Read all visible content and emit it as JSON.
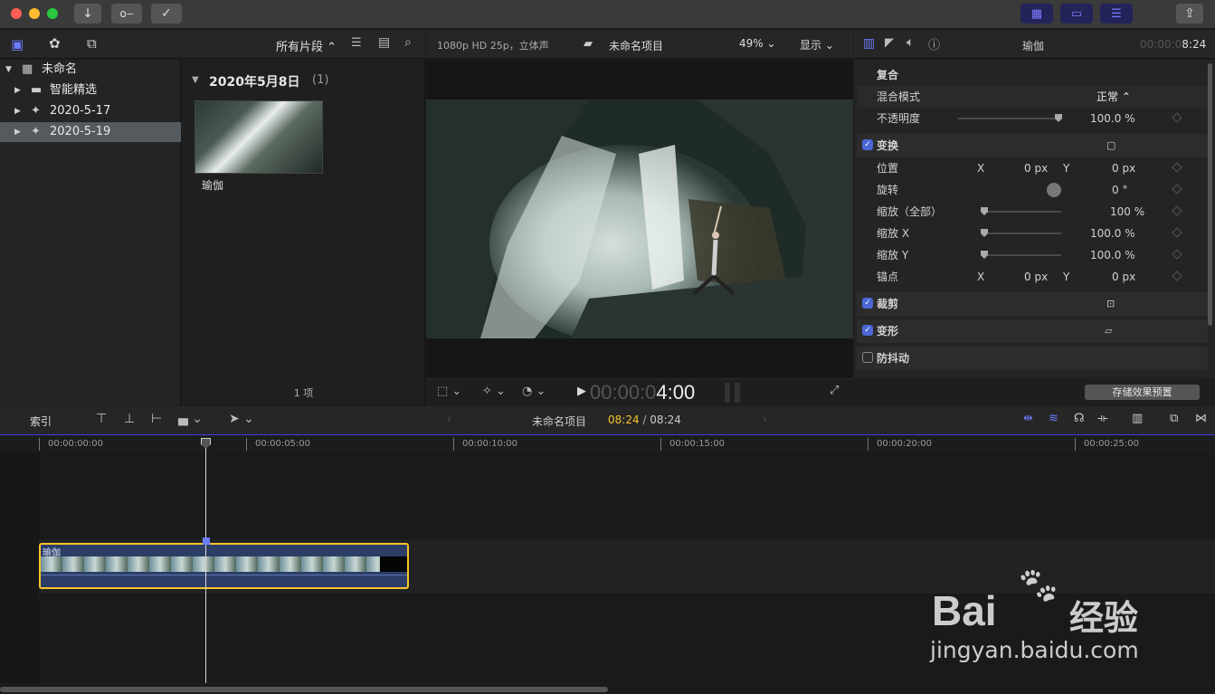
{
  "colors": {
    "accent": "#4b67d6",
    "yellow": "#f7c52a",
    "titlebar": "#3a3a3a"
  },
  "titlebar": {
    "icons": [
      "import-icon",
      "key-icon",
      "checkmark-circle-icon",
      "browser-grid-icon",
      "timeline-icon",
      "inspector-icon",
      "share-icon"
    ]
  },
  "browser": {
    "filter": "所有片段",
    "library": "未命名",
    "items": [
      {
        "label": "智能精选"
      },
      {
        "label": "2020-5-17"
      },
      {
        "label": "2020-5-19"
      }
    ],
    "date_header": "2020年5月8日",
    "date_count": "(1)",
    "clip_name": "瑜伽",
    "item_count": "1 项"
  },
  "viewer": {
    "format": "1080p HD 25p，立体声",
    "project": "未命名项目",
    "zoom": "49%",
    "display": "显示",
    "timecode_dim": "00:00:0",
    "timecode_bright": "4:00"
  },
  "inspector": {
    "title": "瑜伽",
    "timecode_dim": "00:00:0",
    "timecode_bright": "8:24",
    "composite": "复合",
    "blend_mode_label": "混合模式",
    "blend_mode_value": "正常",
    "opacity_label": "不透明度",
    "opacity_value": "100.0",
    "opacity_level": 1.0,
    "transform": "变换",
    "position_label": "位置",
    "x_label": "X",
    "y_label": "Y",
    "pos_x": "0",
    "pos_y": "0",
    "px": "px",
    "rotation_label": "旋转",
    "rotation_value": "0",
    "degree": "°",
    "scale_all_label": "缩放（全部）",
    "scale_all_value": "100",
    "scale_x_label": "缩放 X",
    "scale_x_value": "100.0",
    "scale_y_label": "缩放 Y",
    "scale_y_value": "100.0",
    "percent": "%",
    "anchor_label": "锚点",
    "anchor_x": "0",
    "anchor_y": "0",
    "crop": "裁剪",
    "distort": "变形",
    "stabilization": "防抖动",
    "save_preset": "存储效果预置"
  },
  "timeline": {
    "index": "索引",
    "project": "未命名项目",
    "current": "08:24",
    "separator": "/",
    "duration": "08:24",
    "clip_label": "瑜伽",
    "ruler": [
      "00:00:00:00",
      "00:00:05:00",
      "00:00:10:00",
      "00:00:15:00",
      "00:00:20:00",
      "00:00:25:00"
    ]
  },
  "watermark": {
    "brand": "Bai",
    "brand_suffix": "经验",
    "url": "jingyan.baidu.com"
  }
}
